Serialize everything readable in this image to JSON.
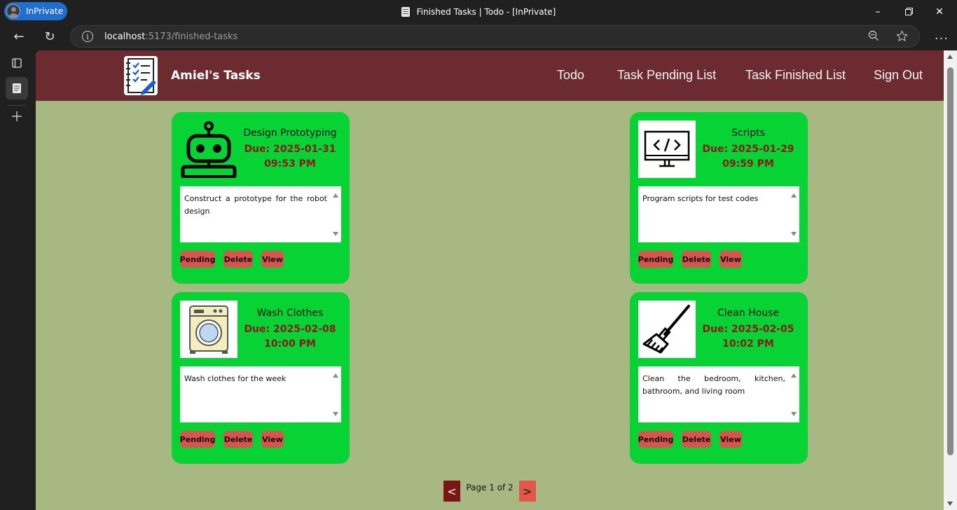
{
  "browser": {
    "profile_label": "InPrivate",
    "tab_title": "Finished Tasks | Todo - [InPrivate]",
    "url_host": "localhost",
    "url_path": ":5173/finished-tasks"
  },
  "header": {
    "brand": "Amiel's Tasks",
    "nav": [
      "Todo",
      "Task Pending List",
      "Task Finished List",
      "Sign Out"
    ]
  },
  "cards": [
    {
      "title": "Design Prototyping",
      "due_date": "Due: 2025-01-31",
      "due_time": "09:53 PM",
      "description": "Construct a prototype for the robot design",
      "icon": "robot-icon"
    },
    {
      "title": "Scripts",
      "due_date": "Due: 2025-01-29",
      "due_time": "09:59 PM",
      "description": "Program scripts for test codes",
      "icon": "code-monitor-icon"
    },
    {
      "title": "Wash Clothes",
      "due_date": "Due: 2025-02-08",
      "due_time": "10:00 PM",
      "description": "Wash clothes for the week",
      "icon": "washing-machine-icon"
    },
    {
      "title": "Clean House",
      "due_date": "Due: 2025-02-05",
      "due_time": "10:02 PM",
      "description": "Clean the bedroom, kitchen, bathroom, and living room",
      "icon": "broom-icon"
    }
  ],
  "actions": {
    "pending": "Pending",
    "delete": "Delete",
    "view": "View"
  },
  "pagination": {
    "prev": "<",
    "next": ">",
    "label": "Page 1 of 2"
  },
  "colors": {
    "page_bg": "#a8b882",
    "header_bg": "#6b2b30",
    "card_bg": "#07d434",
    "due_text": "#8a1a1a",
    "button_bg": "#d9534f"
  }
}
